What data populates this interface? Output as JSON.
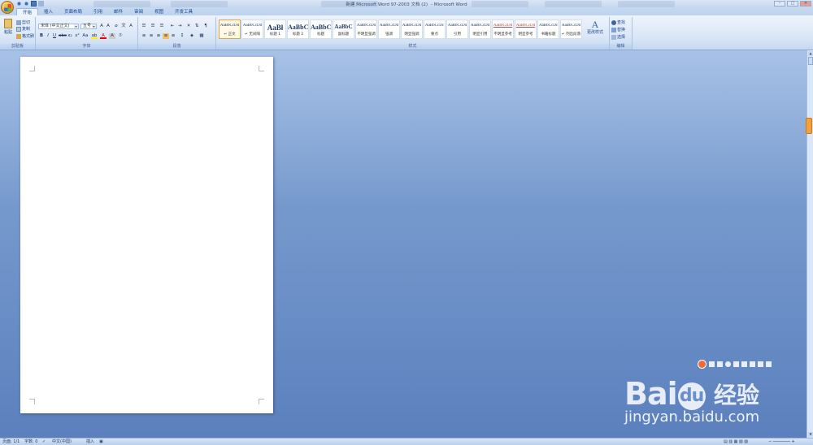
{
  "title_bar": {
    "doc_title": "新建 Microsoft Word 97-2003 文档 (2)",
    "app_title": "Microsoft Word",
    "compat_tag": ""
  },
  "tabs": [
    "开始",
    "插入",
    "页面布局",
    "引用",
    "邮件",
    "审阅",
    "视图",
    "开发工具"
  ],
  "active_tab": "开始",
  "ribbon": {
    "clipboard": {
      "paste": "粘贴",
      "cut": "剪切",
      "copy": "复制",
      "format_painter": "格式刷",
      "label": "剪贴板"
    },
    "font": {
      "font_name": "宋体 (中文正文)",
      "font_size": "五号",
      "label": "字体"
    },
    "paragraph": {
      "label": "段落"
    },
    "styles": {
      "label": "样式",
      "items": [
        {
          "sample": "AaBbCcDd",
          "name": "↵ 正文"
        },
        {
          "sample": "AaBbCcDd",
          "name": "↵ 无间隔"
        },
        {
          "sample": "AaBł",
          "name": "标题 1"
        },
        {
          "sample": "AaBbC",
          "name": "标题 2"
        },
        {
          "sample": "AaBbC",
          "name": "标题"
        },
        {
          "sample": "AaBbC",
          "name": "副标题"
        },
        {
          "sample": "AaBbCcDd",
          "name": "不明显强调"
        },
        {
          "sample": "AaBbCcDd",
          "name": "强调"
        },
        {
          "sample": "AaBbCcDd",
          "name": "明显强调"
        },
        {
          "sample": "AaBbCcDc",
          "name": "要点"
        },
        {
          "sample": "AaBbCcDd",
          "name": "引用"
        },
        {
          "sample": "AaBbCcDd",
          "name": "明显引用"
        },
        {
          "sample": "AaBbCcDd",
          "name": "不明显参考"
        },
        {
          "sample": "AaBbCcDd",
          "name": "明显参考"
        },
        {
          "sample": "AaBbCcDc",
          "name": "书籍标题"
        },
        {
          "sample": "AaBbCcDd",
          "name": "↵ 列出段落"
        }
      ],
      "change_styles": "更改样式"
    },
    "editing": {
      "find": "查找",
      "replace": "替换",
      "select": "选择",
      "label": "编辑"
    }
  },
  "status_bar": {
    "page": "页面: 1/1",
    "words": "字数: 0",
    "language": "中文(中国)",
    "mode": "插入"
  },
  "watermark": {
    "logo_bai": "Bai",
    "logo_du": "du",
    "logo_cn": "经验",
    "url": "jingyan.baidu.com"
  },
  "colors": {
    "accent": "#15428b",
    "workspace_top": "#a8c2e7",
    "workspace_bottom": "#5b80bd"
  }
}
